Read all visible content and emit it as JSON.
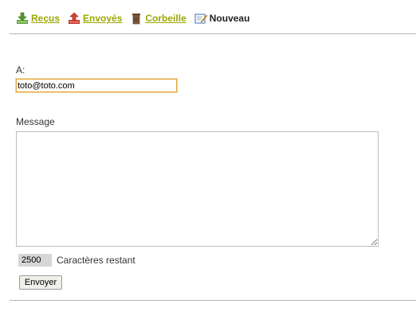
{
  "nav": {
    "items": [
      {
        "label": "Reçus",
        "icon": "inbox-download-icon"
      },
      {
        "label": "Envoyés",
        "icon": "outbox-upload-icon"
      },
      {
        "label": "Corbeille",
        "icon": "trash-bin-icon"
      },
      {
        "label": "Nouveau",
        "icon": "compose-icon"
      }
    ],
    "link_color": "#9aa700"
  },
  "form": {
    "to_label": "A:",
    "to_value": "toto@toto.com",
    "message_label": "Message",
    "message_value": "",
    "remaining_count": "2500",
    "remaining_label": "Caractères restant",
    "send_label": "Envoyer"
  }
}
